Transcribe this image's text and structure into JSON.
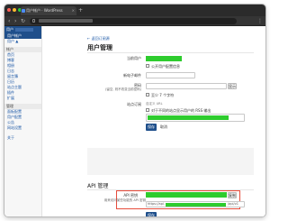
{
  "browser": {
    "tab_title": "用户帐户 · WordPress",
    "close_glyph": "×",
    "new_tab_glyph": "+",
    "back_glyph": "‹",
    "forward_glyph": "›",
    "reload_glyph": "↻",
    "menu_glyph": "⋮"
  },
  "sidebar": {
    "top_label": "用户",
    "items": [
      {
        "label": "用户帐户",
        "active": true
      },
      {
        "label": "用户 ▲",
        "active": false
      }
    ],
    "section1": "帐户",
    "group1": [
      "首页",
      "博客",
      "相册",
      "日志",
      "留言簿",
      "日历",
      "站点主题",
      "插件",
      "扩展"
    ],
    "section2": "管理",
    "group2": [
      "面板配置",
      "用户配置",
      "公告",
      "网站设置"
    ],
    "footer": "关于"
  },
  "main": {
    "back_link": "← 返回订阅源",
    "title": "用户管理",
    "current_user_label": "当前用户",
    "checkbox1_label": "公开用户配置信息",
    "email_label": "新电子邮件",
    "password_label": "密码",
    "password_sub": "(留空, 则不改变当前密码)",
    "show_btn": "显示",
    "hint_label": "至少 7 个字符",
    "notify_label": "站点订阅",
    "notify_sub": "自定义 URL",
    "notify_check": "对于不同的站点显示用户的 RSS 输出",
    "save_btn": "保存",
    "cancel_btn": "取消",
    "api_title": "API 管理",
    "api_key_label": "API 密钥",
    "api_key_sub": "用来访问某些功能的 API 密钥",
    "api_key_copy": "复制",
    "api_url_prefix": "https://api.",
    "api_url_suffix": "/api/v1",
    "api_save_btn": "保存"
  }
}
